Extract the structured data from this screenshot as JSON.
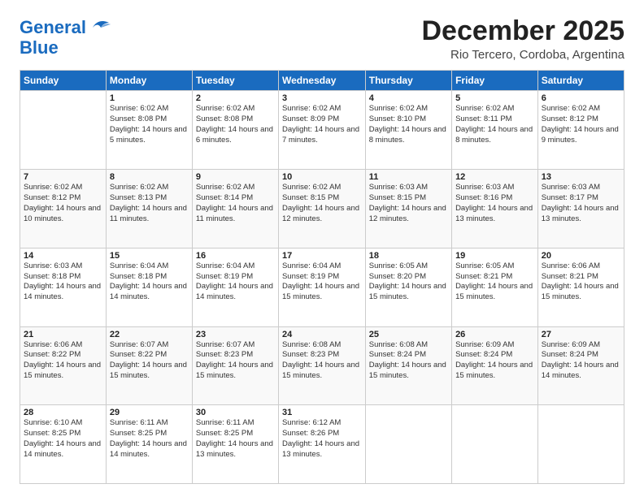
{
  "logo": {
    "line1": "General",
    "line2": "Blue"
  },
  "title": "December 2025",
  "location": "Rio Tercero, Cordoba, Argentina",
  "days_header": [
    "Sunday",
    "Monday",
    "Tuesday",
    "Wednesday",
    "Thursday",
    "Friday",
    "Saturday"
  ],
  "weeks": [
    [
      {
        "num": "",
        "sunrise": "",
        "sunset": "",
        "daylight": ""
      },
      {
        "num": "1",
        "sunrise": "Sunrise: 6:02 AM",
        "sunset": "Sunset: 8:08 PM",
        "daylight": "Daylight: 14 hours and 5 minutes."
      },
      {
        "num": "2",
        "sunrise": "Sunrise: 6:02 AM",
        "sunset": "Sunset: 8:08 PM",
        "daylight": "Daylight: 14 hours and 6 minutes."
      },
      {
        "num": "3",
        "sunrise": "Sunrise: 6:02 AM",
        "sunset": "Sunset: 8:09 PM",
        "daylight": "Daylight: 14 hours and 7 minutes."
      },
      {
        "num": "4",
        "sunrise": "Sunrise: 6:02 AM",
        "sunset": "Sunset: 8:10 PM",
        "daylight": "Daylight: 14 hours and 8 minutes."
      },
      {
        "num": "5",
        "sunrise": "Sunrise: 6:02 AM",
        "sunset": "Sunset: 8:11 PM",
        "daylight": "Daylight: 14 hours and 8 minutes."
      },
      {
        "num": "6",
        "sunrise": "Sunrise: 6:02 AM",
        "sunset": "Sunset: 8:12 PM",
        "daylight": "Daylight: 14 hours and 9 minutes."
      }
    ],
    [
      {
        "num": "7",
        "sunrise": "Sunrise: 6:02 AM",
        "sunset": "Sunset: 8:12 PM",
        "daylight": "Daylight: 14 hours and 10 minutes."
      },
      {
        "num": "8",
        "sunrise": "Sunrise: 6:02 AM",
        "sunset": "Sunset: 8:13 PM",
        "daylight": "Daylight: 14 hours and 11 minutes."
      },
      {
        "num": "9",
        "sunrise": "Sunrise: 6:02 AM",
        "sunset": "Sunset: 8:14 PM",
        "daylight": "Daylight: 14 hours and 11 minutes."
      },
      {
        "num": "10",
        "sunrise": "Sunrise: 6:02 AM",
        "sunset": "Sunset: 8:15 PM",
        "daylight": "Daylight: 14 hours and 12 minutes."
      },
      {
        "num": "11",
        "sunrise": "Sunrise: 6:03 AM",
        "sunset": "Sunset: 8:15 PM",
        "daylight": "Daylight: 14 hours and 12 minutes."
      },
      {
        "num": "12",
        "sunrise": "Sunrise: 6:03 AM",
        "sunset": "Sunset: 8:16 PM",
        "daylight": "Daylight: 14 hours and 13 minutes."
      },
      {
        "num": "13",
        "sunrise": "Sunrise: 6:03 AM",
        "sunset": "Sunset: 8:17 PM",
        "daylight": "Daylight: 14 hours and 13 minutes."
      }
    ],
    [
      {
        "num": "14",
        "sunrise": "Sunrise: 6:03 AM",
        "sunset": "Sunset: 8:18 PM",
        "daylight": "Daylight: 14 hours and 14 minutes."
      },
      {
        "num": "15",
        "sunrise": "Sunrise: 6:04 AM",
        "sunset": "Sunset: 8:18 PM",
        "daylight": "Daylight: 14 hours and 14 minutes."
      },
      {
        "num": "16",
        "sunrise": "Sunrise: 6:04 AM",
        "sunset": "Sunset: 8:19 PM",
        "daylight": "Daylight: 14 hours and 14 minutes."
      },
      {
        "num": "17",
        "sunrise": "Sunrise: 6:04 AM",
        "sunset": "Sunset: 8:19 PM",
        "daylight": "Daylight: 14 hours and 15 minutes."
      },
      {
        "num": "18",
        "sunrise": "Sunrise: 6:05 AM",
        "sunset": "Sunset: 8:20 PM",
        "daylight": "Daylight: 14 hours and 15 minutes."
      },
      {
        "num": "19",
        "sunrise": "Sunrise: 6:05 AM",
        "sunset": "Sunset: 8:21 PM",
        "daylight": "Daylight: 14 hours and 15 minutes."
      },
      {
        "num": "20",
        "sunrise": "Sunrise: 6:06 AM",
        "sunset": "Sunset: 8:21 PM",
        "daylight": "Daylight: 14 hours and 15 minutes."
      }
    ],
    [
      {
        "num": "21",
        "sunrise": "Sunrise: 6:06 AM",
        "sunset": "Sunset: 8:22 PM",
        "daylight": "Daylight: 14 hours and 15 minutes."
      },
      {
        "num": "22",
        "sunrise": "Sunrise: 6:07 AM",
        "sunset": "Sunset: 8:22 PM",
        "daylight": "Daylight: 14 hours and 15 minutes."
      },
      {
        "num": "23",
        "sunrise": "Sunrise: 6:07 AM",
        "sunset": "Sunset: 8:23 PM",
        "daylight": "Daylight: 14 hours and 15 minutes."
      },
      {
        "num": "24",
        "sunrise": "Sunrise: 6:08 AM",
        "sunset": "Sunset: 8:23 PM",
        "daylight": "Daylight: 14 hours and 15 minutes."
      },
      {
        "num": "25",
        "sunrise": "Sunrise: 6:08 AM",
        "sunset": "Sunset: 8:24 PM",
        "daylight": "Daylight: 14 hours and 15 minutes."
      },
      {
        "num": "26",
        "sunrise": "Sunrise: 6:09 AM",
        "sunset": "Sunset: 8:24 PM",
        "daylight": "Daylight: 14 hours and 15 minutes."
      },
      {
        "num": "27",
        "sunrise": "Sunrise: 6:09 AM",
        "sunset": "Sunset: 8:24 PM",
        "daylight": "Daylight: 14 hours and 14 minutes."
      }
    ],
    [
      {
        "num": "28",
        "sunrise": "Sunrise: 6:10 AM",
        "sunset": "Sunset: 8:25 PM",
        "daylight": "Daylight: 14 hours and 14 minutes."
      },
      {
        "num": "29",
        "sunrise": "Sunrise: 6:11 AM",
        "sunset": "Sunset: 8:25 PM",
        "daylight": "Daylight: 14 hours and 14 minutes."
      },
      {
        "num": "30",
        "sunrise": "Sunrise: 6:11 AM",
        "sunset": "Sunset: 8:25 PM",
        "daylight": "Daylight: 14 hours and 13 minutes."
      },
      {
        "num": "31",
        "sunrise": "Sunrise: 6:12 AM",
        "sunset": "Sunset: 8:26 PM",
        "daylight": "Daylight: 14 hours and 13 minutes."
      },
      {
        "num": "",
        "sunrise": "",
        "sunset": "",
        "daylight": ""
      },
      {
        "num": "",
        "sunrise": "",
        "sunset": "",
        "daylight": ""
      },
      {
        "num": "",
        "sunrise": "",
        "sunset": "",
        "daylight": ""
      }
    ]
  ]
}
